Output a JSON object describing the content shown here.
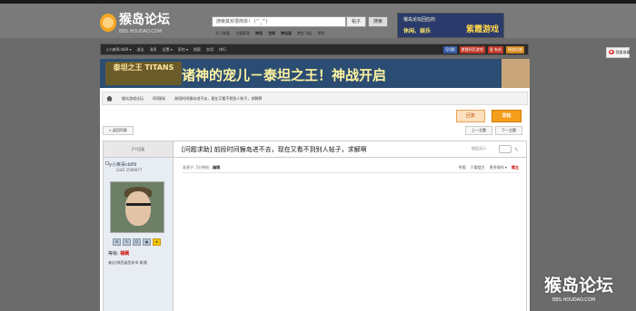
{
  "header": {
    "site_name": "猴岛论坛",
    "site_url": "BBS.HOUDAO.COM",
    "search_placeholder": "搜索其实很简单！ (^_^)",
    "search_scope": "帖子",
    "search_button": "搜索",
    "hot_words": [
      "凡人修真",
      "大唐真龙",
      "神佳",
      "龙将",
      "神仙道",
      "梦幻飞仙",
      "寻找"
    ],
    "promo_line1": "猴岛论坛回应的",
    "promo_line2": "休闲、娱乐",
    "promo_brand": "紫霞游戏"
  },
  "nav": {
    "items": [
      "y小爽哥cb89 ▾",
      "退出",
      "消息",
      "设置 ▾",
      "家的 ▾",
      "搜索",
      "实用",
      "排行"
    ],
    "right_buttons": [
      "QQ群",
      "紫霞网页游戏",
      "爱 有米",
      "网游设施"
    ]
  },
  "fav": {
    "label": "我要收藏"
  },
  "banner": {
    "logo_text": "泰坦之王 TITANS",
    "slogan": "诸神的宠儿－泰坦之王！神战开启"
  },
  "breadcrumb": {
    "items": [
      "猴岛游戏论坛",
      "QQ图标",
      "前段时间猴岛进不去，现在又看不到别人帖子，求解啊"
    ]
  },
  "actions": {
    "reply": "回复",
    "post": "发帖",
    "back_to_list": "« 返回列表",
    "prev_topic": "上一主题",
    "next_topic": "下一主题"
  },
  "thread": {
    "reply_count": "2个回复",
    "title": "[问题求助] 前段时间猴岛进不去，现在又看不到别人帖子，求解啊",
    "view_mode_label": "楼层显示"
  },
  "author": {
    "name": "y小爽哥cb89",
    "uid": "ZxID 2589877",
    "icons": [
      "✉",
      "✎",
      "☺",
      "▣",
      "★"
    ],
    "level_label": "等级:",
    "level_value": "禄刷",
    "location": "来自:陕西省西安市 联通"
  },
  "post": {
    "time_label": "发表于:",
    "time_value": "5分钟前",
    "edit": "编辑",
    "ops": [
      "举报",
      "只看楼主",
      "更多操作 ▾"
    ],
    "floor": "楼主"
  },
  "corner": {
    "logo": "猴岛论坛",
    "url": "BBS.HOUDAO.COM"
  }
}
